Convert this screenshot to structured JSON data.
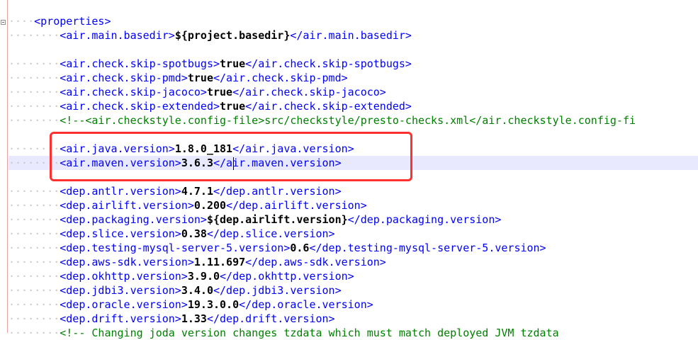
{
  "editor": {
    "lines": [
      {
        "indent": "····",
        "parts": [
          {
            "t": "tag",
            "v": "<properties>"
          }
        ]
      },
      {
        "indent": "········",
        "parts": [
          {
            "t": "tag",
            "v": "<air.main.basedir>"
          },
          {
            "t": "val",
            "v": "${project.basedir}"
          },
          {
            "t": "tag",
            "v": "</air.main.basedir>"
          }
        ]
      },
      {
        "indent": "",
        "parts": []
      },
      {
        "indent": "········",
        "parts": [
          {
            "t": "tag",
            "v": "<air.check.skip-spotbugs>"
          },
          {
            "t": "val",
            "v": "true"
          },
          {
            "t": "tag",
            "v": "</air.check.skip-spotbugs>"
          }
        ]
      },
      {
        "indent": "········",
        "parts": [
          {
            "t": "tag",
            "v": "<air.check.skip-pmd>"
          },
          {
            "t": "val",
            "v": "true"
          },
          {
            "t": "tag",
            "v": "</air.check.skip-pmd>"
          }
        ]
      },
      {
        "indent": "········",
        "parts": [
          {
            "t": "tag",
            "v": "<air.check.skip-jacoco>"
          },
          {
            "t": "val",
            "v": "true"
          },
          {
            "t": "tag",
            "v": "</air.check.skip-jacoco>"
          }
        ]
      },
      {
        "indent": "········",
        "parts": [
          {
            "t": "tag",
            "v": "<air.check.skip-extended>"
          },
          {
            "t": "val",
            "v": "true"
          },
          {
            "t": "tag",
            "v": "</air.check.skip-extended>"
          }
        ]
      },
      {
        "indent": "········",
        "parts": [
          {
            "t": "cmt",
            "v": "<!--<air.checkstyle.config-file>src/checkstyle/presto-checks.xml</air.checkstyle.config-fi"
          }
        ]
      },
      {
        "indent": "",
        "parts": []
      },
      {
        "indent": "········",
        "parts": [
          {
            "t": "tag",
            "v": "<air.java.version>"
          },
          {
            "t": "val",
            "v": "1.8.0_181"
          },
          {
            "t": "tag",
            "v": "</air.java.version>"
          }
        ]
      },
      {
        "indent": "········",
        "current": true,
        "parts": [
          {
            "t": "tag",
            "v": "<air.maven.version>"
          },
          {
            "t": "val",
            "v": "3.6.3"
          },
          {
            "t": "tag",
            "v": "</air.maven.version>"
          }
        ]
      },
      {
        "indent": "",
        "parts": []
      },
      {
        "indent": "········",
        "parts": [
          {
            "t": "tag",
            "v": "<dep.antlr.version>"
          },
          {
            "t": "val",
            "v": "4.7.1"
          },
          {
            "t": "tag",
            "v": "</dep.antlr.version>"
          }
        ]
      },
      {
        "indent": "········",
        "parts": [
          {
            "t": "tag",
            "v": "<dep.airlift.version>"
          },
          {
            "t": "val",
            "v": "0.200"
          },
          {
            "t": "tag",
            "v": "</dep.airlift.version>"
          }
        ]
      },
      {
        "indent": "········",
        "parts": [
          {
            "t": "tag",
            "v": "<dep.packaging.version>"
          },
          {
            "t": "val",
            "v": "${dep.airlift.version}"
          },
          {
            "t": "tag",
            "v": "</dep.packaging.version>"
          }
        ]
      },
      {
        "indent": "········",
        "parts": [
          {
            "t": "tag",
            "v": "<dep.slice.version>"
          },
          {
            "t": "val",
            "v": "0.38"
          },
          {
            "t": "tag",
            "v": "</dep.slice.version>"
          }
        ]
      },
      {
        "indent": "········",
        "parts": [
          {
            "t": "tag",
            "v": "<dep.testing-mysql-server-5.version>"
          },
          {
            "t": "val",
            "v": "0.6"
          },
          {
            "t": "tag",
            "v": "</dep.testing-mysql-server-5.version>"
          }
        ]
      },
      {
        "indent": "········",
        "parts": [
          {
            "t": "tag",
            "v": "<dep.aws-sdk.version>"
          },
          {
            "t": "val",
            "v": "1.11.697"
          },
          {
            "t": "tag",
            "v": "</dep.aws-sdk.version>"
          }
        ]
      },
      {
        "indent": "········",
        "parts": [
          {
            "t": "tag",
            "v": "<dep.okhttp.version>"
          },
          {
            "t": "val",
            "v": "3.9.0"
          },
          {
            "t": "tag",
            "v": "</dep.okhttp.version>"
          }
        ]
      },
      {
        "indent": "········",
        "parts": [
          {
            "t": "tag",
            "v": "<dep.jdbi3.version>"
          },
          {
            "t": "val",
            "v": "3.4.0"
          },
          {
            "t": "tag",
            "v": "</dep.jdbi3.version>"
          }
        ]
      },
      {
        "indent": "········",
        "parts": [
          {
            "t": "tag",
            "v": "<dep.oracle.version>"
          },
          {
            "t": "val",
            "v": "19.3.0.0"
          },
          {
            "t": "tag",
            "v": "</dep.oracle.version>"
          }
        ]
      },
      {
        "indent": "········",
        "parts": [
          {
            "t": "tag",
            "v": "<dep.drift.version>"
          },
          {
            "t": "val",
            "v": "1.33"
          },
          {
            "t": "tag",
            "v": "</dep.drift.version>"
          }
        ]
      },
      {
        "indent": "········",
        "parts": [
          {
            "t": "cmt",
            "v": "<!-- Changing joda version changes tzdata which must match deployed JVM tzdata"
          }
        ]
      }
    ]
  },
  "colors": {
    "tag": "#0000ff",
    "value": "#000000",
    "comment": "#008000",
    "annotation_box": "#ff3030",
    "current_line": "#e8e8ff"
  }
}
